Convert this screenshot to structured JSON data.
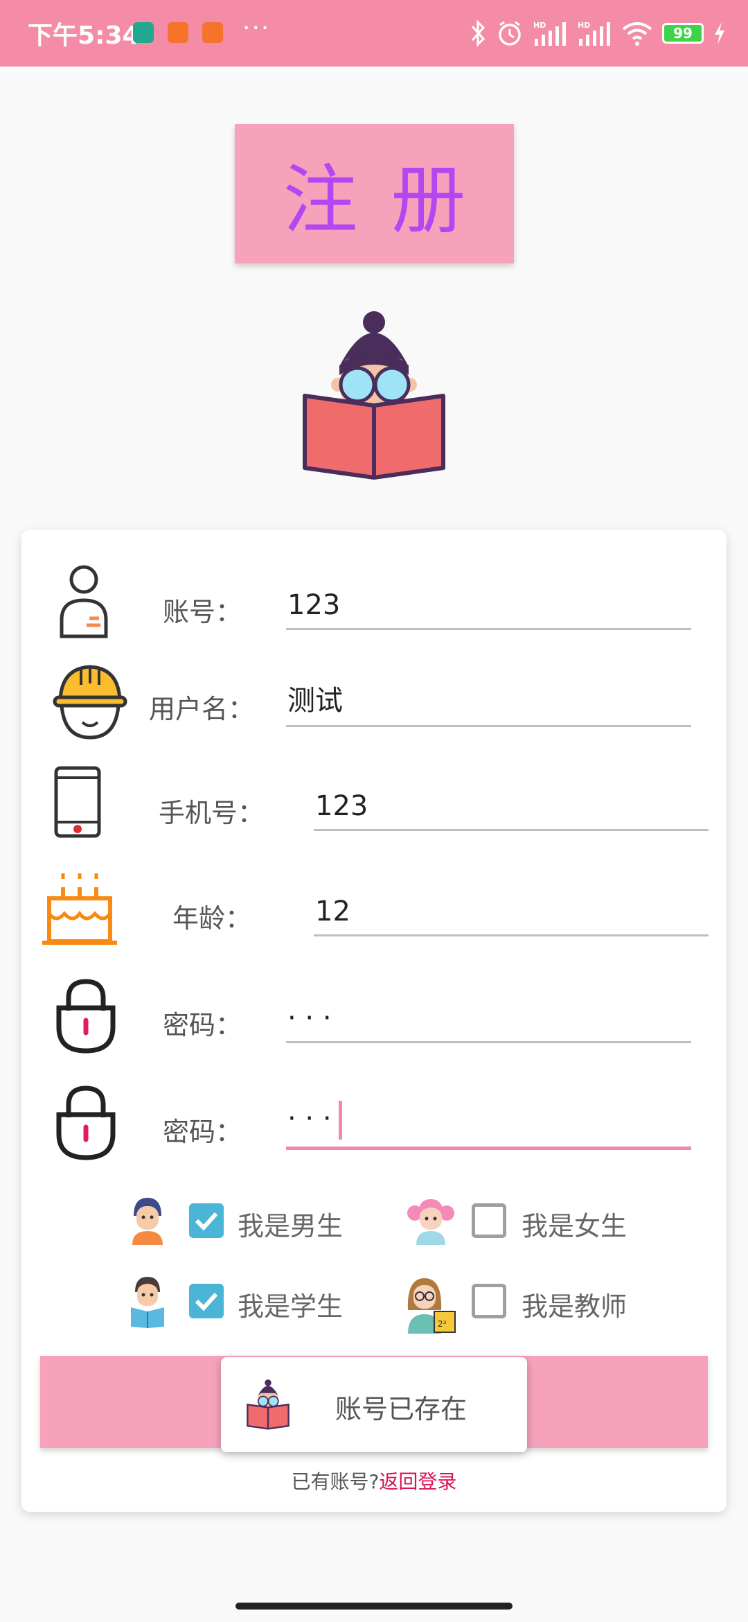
{
  "status_bar": {
    "time": "下午5:34",
    "dots": "···",
    "battery": "99",
    "icons": [
      "bluetooth-icon",
      "alarm-icon",
      "signal-hd-icon",
      "signal-hd-icon",
      "wifi-icon",
      "battery-icon",
      "charging-icon"
    ]
  },
  "title": "注册",
  "form": {
    "account": {
      "label": "账号：",
      "value": "123",
      "icon": "person-icon"
    },
    "username": {
      "label": "用户名：",
      "value": "测试",
      "icon": "helmet-icon"
    },
    "phone": {
      "label": "手机号：",
      "value": "123",
      "icon": "phone-icon"
    },
    "age": {
      "label": "年龄：",
      "value": "12",
      "icon": "cake-icon"
    },
    "password": {
      "label": "密码：",
      "value": "· · ·",
      "icon": "lock-icon"
    },
    "password_confirm": {
      "label": "密码：",
      "value": "· · ·",
      "icon": "lock-icon"
    }
  },
  "options": {
    "male": {
      "label": "我是男生",
      "checked": true
    },
    "female": {
      "label": "我是女生",
      "checked": false
    },
    "student": {
      "label": "我是学生",
      "checked": true
    },
    "teacher": {
      "label": "我是教师",
      "checked": false
    }
  },
  "toast": {
    "text": "账号已存在"
  },
  "footer": {
    "prompt": "已有账号?",
    "link": "返回登录"
  },
  "colors": {
    "accent": "#f48ca8",
    "title_text": "#b546f2",
    "checkbox": "#4bb5d6",
    "link": "#d6145a"
  }
}
